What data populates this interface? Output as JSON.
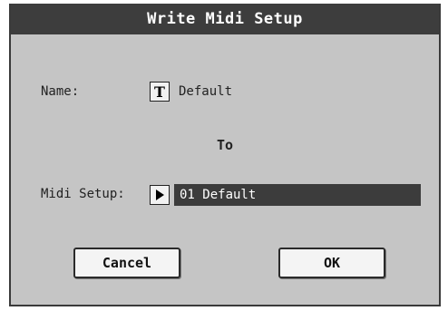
{
  "dialog": {
    "title": "Write Midi Setup",
    "name_label": "Name:",
    "name_value": "Default",
    "to_label": "To",
    "midi_setup_label": "Midi Setup:",
    "midi_setup_value": "01 Default",
    "cancel_label": "Cancel",
    "ok_label": "OK"
  },
  "icons": {
    "text_edit": "text-edit-icon",
    "select_arrow": "play-arrow-icon"
  },
  "colors": {
    "titlebar": "#3d3d3d",
    "background": "#c5c5c5",
    "field": "#3c3c3c",
    "button": "#f4f4f4"
  }
}
